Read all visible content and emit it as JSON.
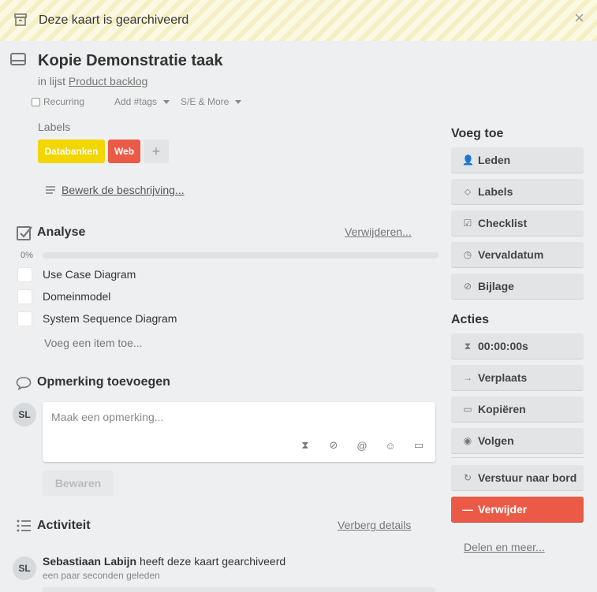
{
  "banner": {
    "text": "Deze kaart is gearchiveerd",
    "close": "×"
  },
  "card": {
    "title": "Kopie Demonstratie taak",
    "in_list_prefix": "in lijst",
    "list_name": "Product backlog"
  },
  "options": {
    "recurring": "Recurring",
    "tags": "Add #tags",
    "se_more": "S/E & More"
  },
  "labels": {
    "heading": "Labels",
    "items": [
      {
        "text": "Databanken",
        "color": "#f2d600"
      },
      {
        "text": "Web",
        "color": "#eb5a46"
      }
    ],
    "add": "+"
  },
  "description": {
    "edit_label": "Bewerk de beschrijving..."
  },
  "checklist": {
    "title": "Analyse",
    "delete": "Verwijderen...",
    "percent_text": "0%",
    "progress": 0,
    "items": [
      "Use Case Diagram",
      "Domeinmodel",
      "System Sequence Diagram"
    ],
    "add_item": "Voeg een item toe..."
  },
  "comment": {
    "title": "Opmerking toevoegen",
    "avatar": "SL",
    "placeholder": "Maak een opmerking...",
    "save": "Bewaren"
  },
  "activity": {
    "title": "Activiteit",
    "toggle": "Verberg details",
    "entries": [
      {
        "avatar": "SL",
        "user": "Sebastiaan Labijn",
        "action": "heeft deze kaart gearchiveerd",
        "time": "een paar seconden geleden"
      }
    ]
  },
  "sidebar": {
    "add_heading": "Voeg toe",
    "add_buttons": [
      {
        "icon": "person-icon",
        "label": "Leden"
      },
      {
        "icon": "tag-icon",
        "label": "Labels"
      },
      {
        "icon": "checkbox-icon",
        "label": "Checklist"
      },
      {
        "icon": "clock-icon",
        "label": "Vervaldatum"
      },
      {
        "icon": "paperclip-icon",
        "label": "Bijlage"
      }
    ],
    "actions_heading": "Acties",
    "action_buttons": [
      {
        "icon": "hourglass-icon",
        "label": "00:00:00s"
      },
      {
        "icon": "arrow-right-icon",
        "label": "Verplaats"
      },
      {
        "icon": "card-icon",
        "label": "Kopiëren"
      },
      {
        "icon": "eye-icon",
        "label": "Volgen"
      }
    ],
    "send_to_board": "Verstuur naar bord",
    "delete": "Verwijder",
    "share": "Delen en meer..."
  },
  "colors": {
    "danger": "#eb5a46",
    "label_yellow": "#f2d600",
    "banner_stripe": "#f4efc4"
  }
}
